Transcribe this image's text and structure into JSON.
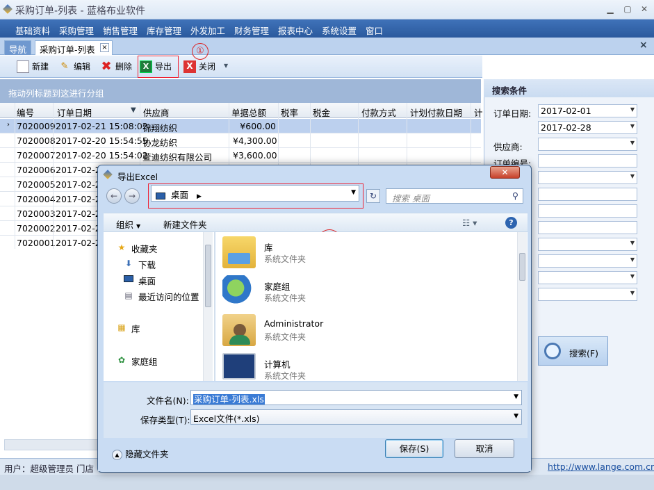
{
  "app": {
    "title": "采购订单-列表 - 蓝格布业软件"
  },
  "menu": [
    "基础资料",
    "采购管理",
    "销售管理",
    "库存管理",
    "外发加工",
    "财务管理",
    "报表中心",
    "系统设置",
    "窗口"
  ],
  "tabs": {
    "nav": "导航",
    "current": "采购订单-列表",
    "tab_close": "×",
    "panel_close": "×"
  },
  "toolbar": {
    "new": "新建",
    "edit": "编辑",
    "delete": "删除",
    "export": "导出",
    "close": "关闭"
  },
  "annotations": {
    "one": "①",
    "two": "②"
  },
  "grid": {
    "group_hint": "拖动列标题到这进行分组",
    "columns": [
      "编号",
      "订单日期",
      "供应商",
      "单据总额",
      "税率",
      "税金",
      "付款方式",
      "计划付款日期",
      "计"
    ],
    "rows": [
      {
        "id": "7020009",
        "date": "2017-02-21 15:08:02",
        "supplier": "锦翔纺织",
        "total": "¥600.00"
      },
      {
        "id": "7020008",
        "date": "2017-02-20 15:54:55",
        "supplier": "协龙纺织",
        "total": "¥4,300.00"
      },
      {
        "id": "7020007",
        "date": "2017-02-20 15:54:02",
        "supplier": "萱迪纺织有限公司",
        "total": "¥3,600.00"
      },
      {
        "id": "7020006",
        "date": "2017-02-20",
        "supplier": "",
        "total": ""
      },
      {
        "id": "7020005",
        "date": "2017-02-20",
        "supplier": "",
        "total": ""
      },
      {
        "id": "7020004",
        "date": "2017-02-20",
        "supplier": "",
        "total": ""
      },
      {
        "id": "7020003",
        "date": "2017-02-20",
        "supplier": "",
        "total": ""
      },
      {
        "id": "7020002",
        "date": "2017-02-20",
        "supplier": "",
        "total": ""
      },
      {
        "id": "7020001",
        "date": "2017-02-20",
        "supplier": "",
        "total": ""
      }
    ]
  },
  "search_panel": {
    "title": "搜索条件",
    "order_date_label": "订单日期:",
    "date_from": "2017-02-01",
    "date_to": "2017-02-28",
    "supplier_label": "供应商:",
    "order_no_label": "订单编号:",
    "search_button": "搜索(F)"
  },
  "status": {
    "user": "用户：超级管理员  门店",
    "url": "http://www.lange.com.cn"
  },
  "dialog": {
    "title": "导出Excel",
    "location": "桌面",
    "search_placeholder": "搜索 桌面",
    "organize": "组织",
    "new_folder": "新建文件夹",
    "nav": {
      "favorites": "收藏夹",
      "downloads": "下载",
      "desktop": "桌面",
      "recent": "最近访问的位置",
      "libraries": "库",
      "homegroup": "家庭组"
    },
    "items": [
      {
        "name": "库",
        "type": "系统文件夹"
      },
      {
        "name": "家庭组",
        "type": "系统文件夹"
      },
      {
        "name": "Administrator",
        "type": "系统文件夹"
      },
      {
        "name": "计算机",
        "type": "系统文件夹"
      }
    ],
    "filename_label": "文件名(N):",
    "filename": "采购订单-列表.xls",
    "filetype_label": "保存类型(T):",
    "filetype": "Excel文件(*.xls)",
    "hide_folders": "隐藏文件夹",
    "save": "保存(S)",
    "cancel": "取消"
  }
}
